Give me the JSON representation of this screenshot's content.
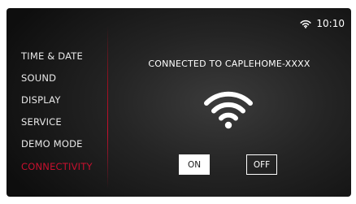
{
  "status_bar": {
    "wifi_icon": "wifi-icon",
    "time": "10:10"
  },
  "menu": {
    "items": [
      {
        "label": "TIME & DATE",
        "active": false
      },
      {
        "label": "SOUND",
        "active": false
      },
      {
        "label": "DISPLAY",
        "active": false
      },
      {
        "label": "SERVICE",
        "active": false
      },
      {
        "label": "DEMO MODE",
        "active": false
      },
      {
        "label": "CONNECTIVITY",
        "active": true
      }
    ]
  },
  "panel": {
    "title": "CONNECTED TO CAPLEHOME-XXXX",
    "icon": "wifi-icon",
    "buttons": {
      "on_label": "ON",
      "off_label": "OFF",
      "selected": "ON"
    }
  },
  "colors": {
    "accent": "#c8102e",
    "background": "#1c1c1c",
    "text": "#ffffff"
  }
}
